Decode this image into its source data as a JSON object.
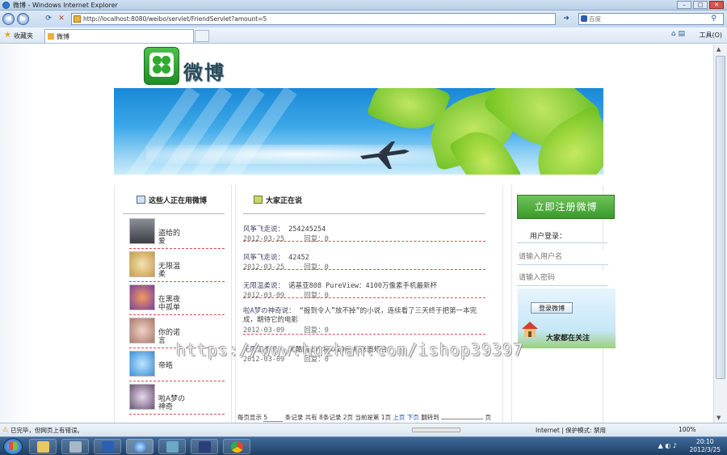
{
  "browser": {
    "window_title": "微博 - Windows Internet Explorer",
    "address": "http://localhost:8080/weibo/servlet/FriendServlet?amount=5",
    "search_placeholder": "百度",
    "favorites_label": "收藏夹",
    "tab_title": "微博",
    "tools_label": "工具(O)",
    "status_text": "已完毕，但网页上有错误。",
    "zone_text": "Internet | 保护模式: 禁用",
    "zoom": "100%"
  },
  "site": {
    "logo_text": "微博"
  },
  "left_column": {
    "title": "这些人正在用微博",
    "users": [
      {
        "name": "盗给的爱"
      },
      {
        "name": "无限温柔"
      },
      {
        "name": "在黑夜中孤单"
      },
      {
        "name": "你的诺言"
      },
      {
        "name": "帝皓"
      },
      {
        "name": "啦A梦の神奇"
      }
    ]
  },
  "middle_column": {
    "title": "大家正在说",
    "posts": [
      {
        "who": "风筝飞走说：",
        "text": "254245254",
        "date": "2012-03-25",
        "reply": "回复：0"
      },
      {
        "who": "风筝飞走说：",
        "text": "42452",
        "date": "2012-03-25",
        "reply": "回复：0"
      },
      {
        "who": "无限温柔说：",
        "text": "诺基亚808 PureView：4100万像素手机最新杯",
        "date": "2012-03-09",
        "reply": "回复：0"
      },
      {
        "who": "啦A梦の神奇说：",
        "text": "“报到令人”放不掉”的小说，连续看了三天终于把第一本完成，期待它的电影",
        "date": "2012-03-09",
        "reply": "回复：0"
      },
      {
        "who": "无限温柔说：",
        "text": "优酷网上市将以100%枚账面规合",
        "date": "2012-03-09",
        "reply": "回复：0"
      }
    ],
    "pager": {
      "per_page_label": "每页显示",
      "per_page": "5",
      "record_text": "条记录 共有 8条记录 2页 当前是第 1页",
      "prev": "上页",
      "next": "下页",
      "jump": "翻转到",
      "page_suffix": "页"
    }
  },
  "right_column": {
    "register_button": "立即注册微博",
    "login_title": "用户登录：",
    "username_placeholder": "请输入用户名",
    "password_placeholder": "请输入密码",
    "login_button": "登录微博",
    "followers_label": "大家都在关注"
  },
  "watermark": "https://www.huzhan.com/ishop39397",
  "taskbar": {
    "time": "20:10",
    "date": "2012/3/25"
  }
}
